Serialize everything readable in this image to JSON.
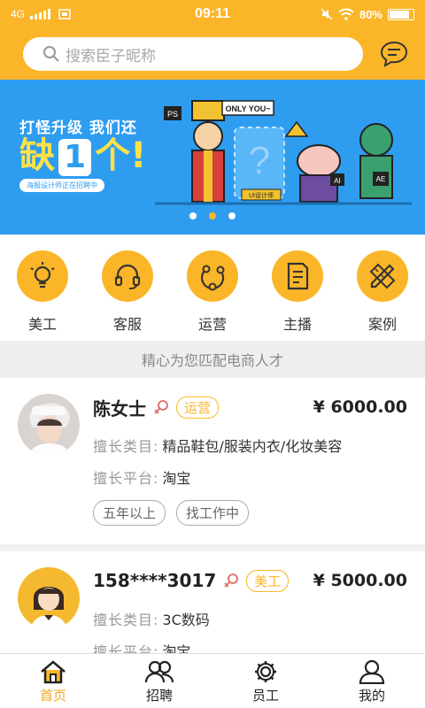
{
  "status_bar": {
    "network": "4G",
    "time": "09:11",
    "battery": "80%",
    "battery_level": 0.8
  },
  "search": {
    "placeholder": "搜索臣子昵称"
  },
  "banner": {
    "line1": "打怪升级 我们还",
    "big_pre": "缺",
    "big_num": "1",
    "big_post": "个",
    "line3": "海报设计师正在招聘中",
    "bubble": "ONLY YOU~",
    "sign": "UI设计师",
    "tag_ps": "PS",
    "tag_ai": "AI",
    "tag_ae": "AE",
    "active_dot": 1
  },
  "categories": [
    {
      "label": "美工",
      "icon": "lightbulb-icon"
    },
    {
      "label": "客服",
      "icon": "headset-icon"
    },
    {
      "label": "运营",
      "icon": "network-icon"
    },
    {
      "label": "主播",
      "icon": "document-icon"
    },
    {
      "label": "案例",
      "icon": "pencil-ruler-icon"
    }
  ],
  "tagline": "精心为您匹配电商人才",
  "talents": [
    {
      "name": "陈女士",
      "role": "运营",
      "salary": "¥ 6000.00",
      "category_key": "擅长类目:",
      "category": "精品鞋包/服装内衣/化妆美容",
      "platform_key": "擅长平台:",
      "platform": "淘宝",
      "tags": [
        "五年以上",
        "找工作中"
      ]
    },
    {
      "name": "158****3017",
      "role": "美工",
      "salary": "¥ 5000.00",
      "category_key": "擅长类目:",
      "category": "3C数码",
      "platform_key": "擅长平台:",
      "platform": "淘宝"
    }
  ],
  "tabs": [
    {
      "label": "首页",
      "icon": "home-icon",
      "active": true
    },
    {
      "label": "招聘",
      "icon": "group-icon",
      "active": false
    },
    {
      "label": "员工",
      "icon": "gear-icon",
      "active": false
    },
    {
      "label": "我的",
      "icon": "person-icon",
      "active": false
    }
  ],
  "colors": {
    "accent": "#fbb528",
    "banner_bg": "#2e9df0",
    "active_tab": "#f3a51c"
  }
}
